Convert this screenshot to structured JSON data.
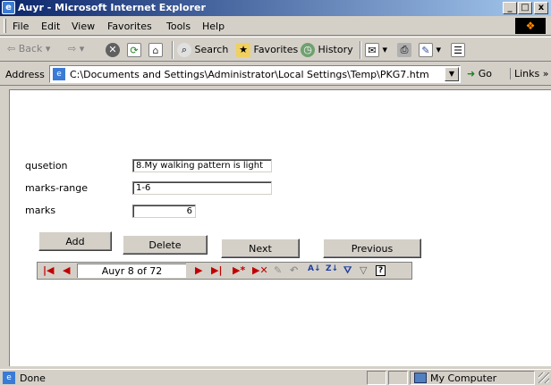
{
  "window": {
    "title": "Auyr - Microsoft Internet Explorer",
    "min": "_",
    "max": "□",
    "close": "x"
  },
  "menu": {
    "items": [
      "File",
      "Edit",
      "View",
      "Favorites",
      "Tools",
      "Help"
    ]
  },
  "toolbar": {
    "back": "Back",
    "back_arrow": "⇦",
    "forward_arrow": "⇨",
    "search": "Search",
    "favorites": "Favorites",
    "history": "History"
  },
  "address": {
    "label": "Address",
    "value": "C:\\Documents and Settings\\Administrator\\Local Settings\\Temp\\PKG7.htm",
    "go": "Go",
    "links": "Links »"
  },
  "form": {
    "question_label": "qusetion",
    "question_value": "8.My walking pattern is light",
    "range_label": "marks-range",
    "range_value": "1-6",
    "marks_label": "marks",
    "marks_value": "6",
    "add": "Add",
    "delete": "Delete",
    "next": "Next",
    "previous": "Previous"
  },
  "navigator": {
    "record_text": "Auyr 8 of 72"
  },
  "status": {
    "text": "Done",
    "zone": "My Computer"
  },
  "colors": {
    "titlebar_start": "#0a246a",
    "titlebar_end": "#a6caf0",
    "chrome": "#d4d0c8",
    "nav_accent": "#c00000"
  }
}
